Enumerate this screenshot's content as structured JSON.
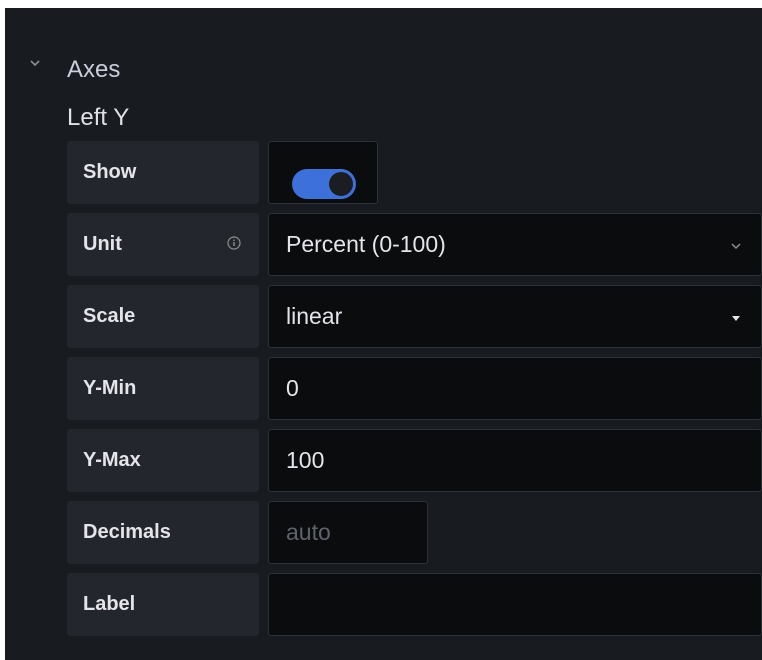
{
  "section": {
    "title": "Axes"
  },
  "group": {
    "title": "Left Y"
  },
  "rows": {
    "show": {
      "label": "Show",
      "value": true
    },
    "unit": {
      "label": "Unit",
      "value": "Percent (0-100)"
    },
    "scale": {
      "label": "Scale",
      "value": "linear"
    },
    "ymin": {
      "label": "Y-Min",
      "value": "0"
    },
    "ymax": {
      "label": "Y-Max",
      "value": "100"
    },
    "decimals": {
      "label": "Decimals",
      "placeholder": "auto"
    },
    "label": {
      "label": "Label",
      "value": ""
    }
  },
  "colors": {
    "background": "#181b1f",
    "label_bg": "#23262c",
    "input_bg": "#0b0c0e",
    "toggle_on": "#3d71d9"
  }
}
